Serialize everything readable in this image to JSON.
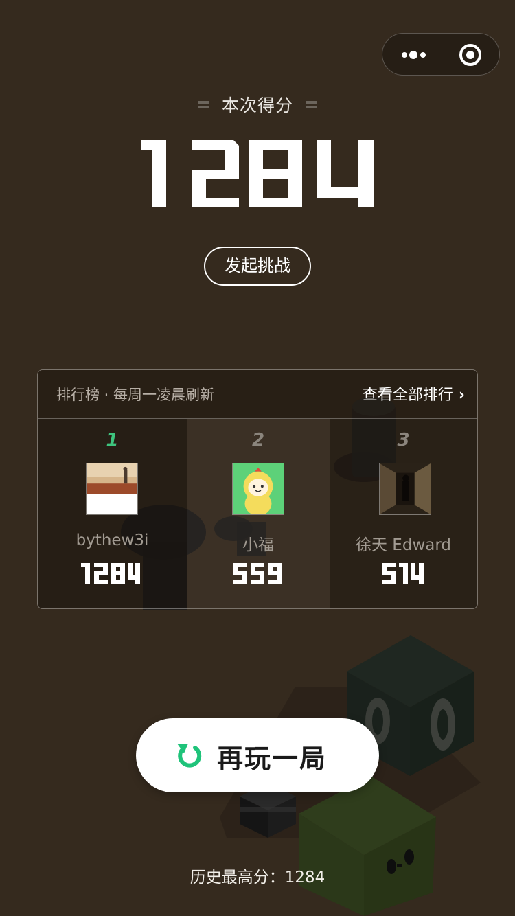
{
  "header": {
    "score_label": "本次得分",
    "score_value": "1284",
    "challenge_button": "发起挑战"
  },
  "leaderboard": {
    "title": "排行榜 · 每周一凌晨刷新",
    "view_all": "查看全部排行",
    "entries": [
      {
        "rank": "1",
        "name": "bythew3i",
        "score": "1284"
      },
      {
        "rank": "2",
        "name": "小福",
        "score": "559"
      },
      {
        "rank": "3",
        "name": "徐天 Edward",
        "score": "514"
      }
    ]
  },
  "replay_button": "再玩一局",
  "best_score_label": "历史最高分：1284",
  "colors": {
    "background": "#352a1e",
    "accent_green": "#3ec47e",
    "text_white": "#ffffff"
  },
  "icons": {
    "menu": "more-dots-icon",
    "close": "target-close-icon",
    "replay": "refresh-icon",
    "chevron": "chevron-right-icon"
  }
}
